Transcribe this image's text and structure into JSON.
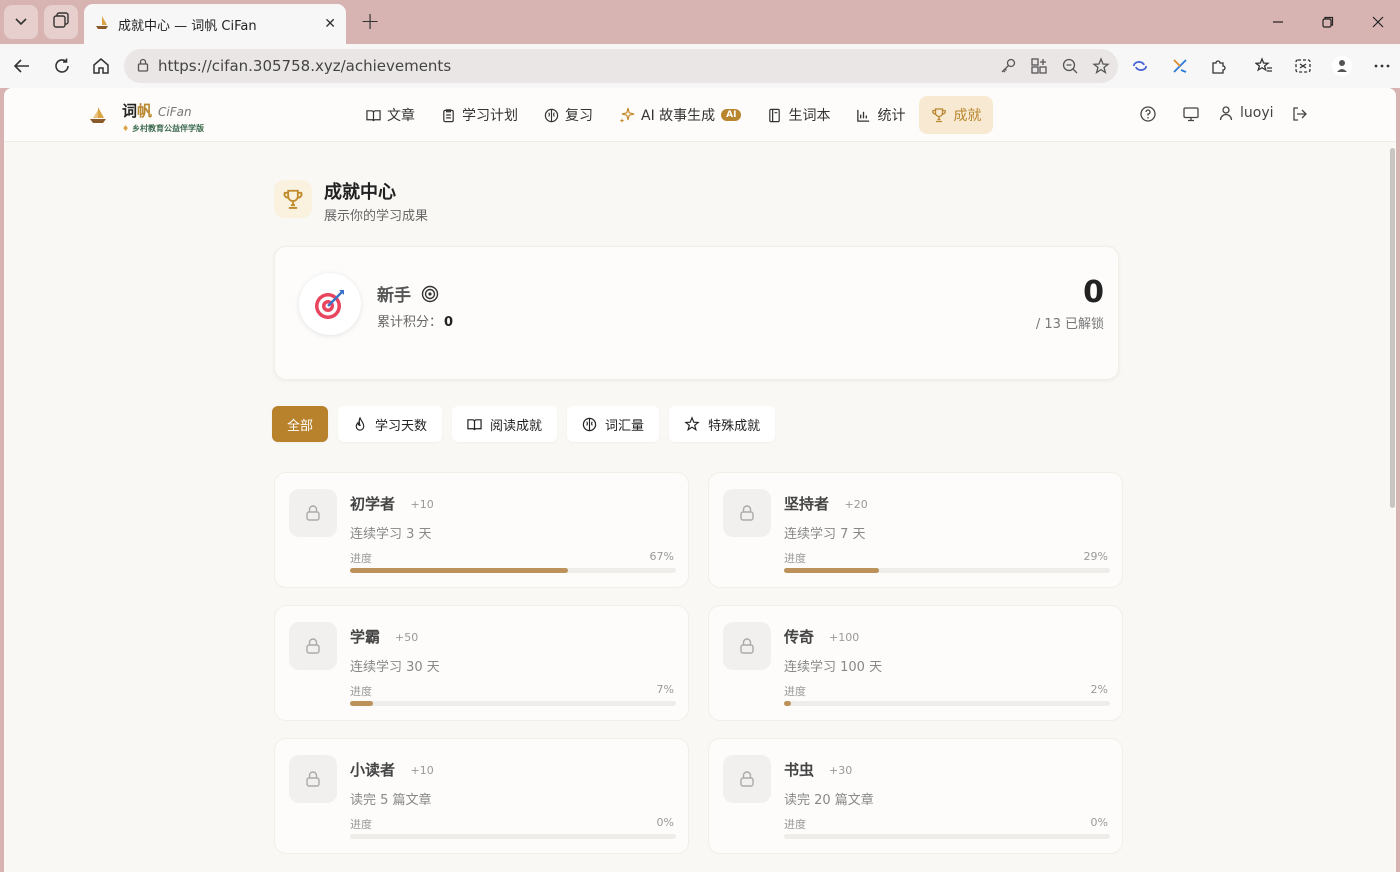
{
  "browser": {
    "tab_title": "成就中心 — 词帆 CiFan",
    "url": "https://cifan.305758.xyz/achievements"
  },
  "site": {
    "logo_main_a": "词",
    "logo_main_b": "帆",
    "logo_en": "CiFan",
    "logo_sub": "乡村教育公益伴学版",
    "menu": [
      {
        "label": "文章",
        "icon": "book-open-icon"
      },
      {
        "label": "学习计划",
        "icon": "clipboard-icon"
      },
      {
        "label": "复习",
        "icon": "brain-icon"
      },
      {
        "label": "AI 故事生成",
        "icon": "sparkles-icon",
        "badge": "AI"
      },
      {
        "label": "生词本",
        "icon": "notebook-icon"
      },
      {
        "label": "统计",
        "icon": "bar-chart-icon"
      },
      {
        "label": "成就",
        "icon": "trophy-icon",
        "active": true
      }
    ],
    "username": "luoyi"
  },
  "page": {
    "title": "成就中心",
    "subtitle": "展示你的学习成果"
  },
  "summary": {
    "level": "新手",
    "points_label": "累计积分：",
    "points": "0",
    "unlocked": "0",
    "total_label": "/ 13 已解锁"
  },
  "filters": [
    {
      "label": "全部",
      "active": true
    },
    {
      "label": "学习天数",
      "icon": "flame-icon"
    },
    {
      "label": "阅读成就",
      "icon": "book-open-icon"
    },
    {
      "label": "词汇量",
      "icon": "brain-icon"
    },
    {
      "label": "特殊成就",
      "icon": "star-icon"
    }
  ],
  "progress_label": "进度",
  "achievements": [
    {
      "name": "初学者",
      "points": "+10",
      "desc": "连续学习 3 天",
      "percent": "67%",
      "progress": 0.67
    },
    {
      "name": "坚持者",
      "points": "+20",
      "desc": "连续学习 7 天",
      "percent": "29%",
      "progress": 0.29
    },
    {
      "name": "学霸",
      "points": "+50",
      "desc": "连续学习 30 天",
      "percent": "7%",
      "progress": 0.07
    },
    {
      "name": "传奇",
      "points": "+100",
      "desc": "连续学习 100 天",
      "percent": "2%",
      "progress": 0.02
    },
    {
      "name": "小读者",
      "points": "+10",
      "desc": "读完 5 篇文章",
      "percent": "0%",
      "progress": 0
    },
    {
      "name": "书虫",
      "points": "+30",
      "desc": "读完 20 篇文章",
      "percent": "0%",
      "progress": 0
    }
  ],
  "colors": {
    "accent": "#b8822d",
    "progress_fill": "#bc925a",
    "active_menu_bg": "#f8ead2"
  }
}
